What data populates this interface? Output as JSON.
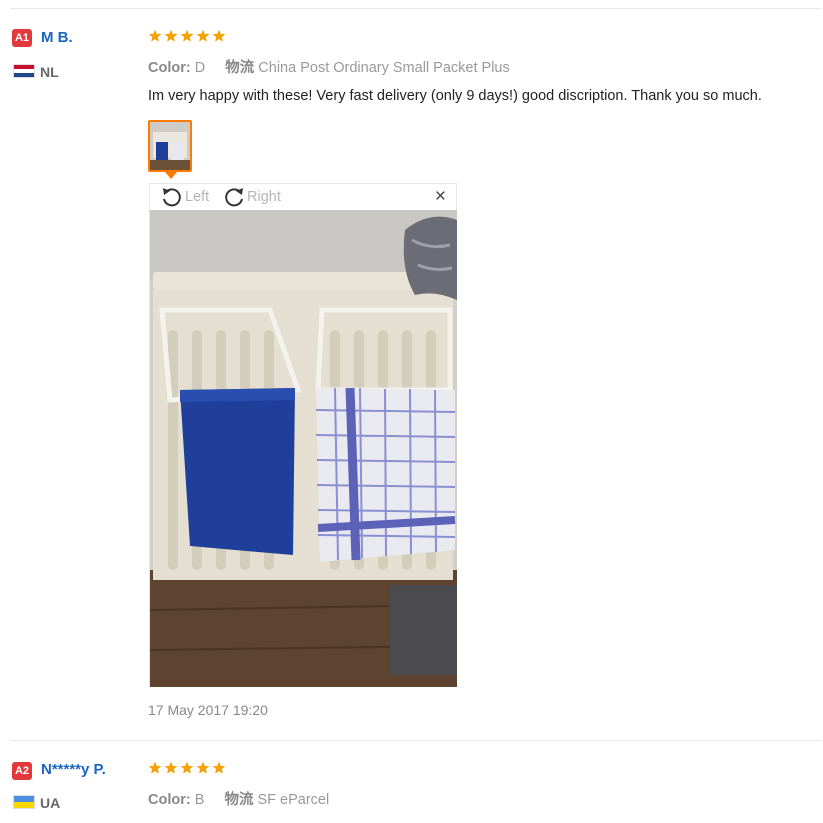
{
  "reviews": [
    {
      "level": "A1",
      "name": "M B.",
      "country": "NL",
      "rating": 5,
      "color_label": "Color:",
      "color_value": "D",
      "shipping_label": "物流",
      "shipping_value": "China Post Ordinary Small Packet Plus",
      "text": "Im very happy with these! Very fast delivery (only 9 days!) good discription. Thank you so much.",
      "date": "17 May 2017 19:20",
      "viewer": {
        "rotate_left_label": "Left",
        "rotate_right_label": "Right",
        "close_label": "×"
      }
    },
    {
      "level": "A2",
      "name": "N*****y P.",
      "country": "UA",
      "rating": 5,
      "color_label": "Color:",
      "color_value": "B",
      "shipping_label": "物流",
      "shipping_value": "SF eParcel"
    }
  ],
  "colors": {
    "star": "#f5a200",
    "badge": "#e4393c",
    "name": "#1a66c2",
    "thumb_border": "#ff7a00"
  },
  "icons": {
    "rotate_left": "rotate-left-icon",
    "rotate_right": "rotate-right-icon",
    "close": "close-icon",
    "star": "star-icon"
  }
}
